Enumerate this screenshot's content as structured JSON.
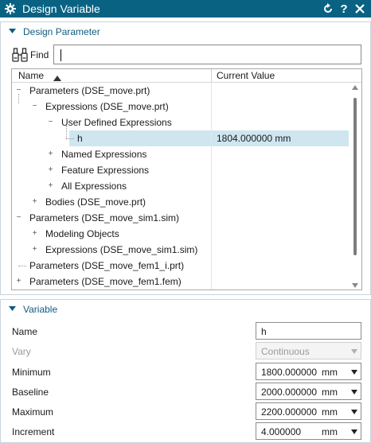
{
  "window": {
    "title": "Design Variable",
    "refresh_icon": "refresh-icon",
    "help_label": "?",
    "close_label": "X"
  },
  "design_parameter": {
    "header": "Design Parameter",
    "find_label": "Find",
    "find_value": "",
    "columns": {
      "name": "Name",
      "current_value": "Current Value"
    },
    "rows": [
      {
        "label": "Parameters (DSE_move.prt)",
        "value": "",
        "state": "expanded"
      },
      {
        "label": "Expressions (DSE_move.prt)",
        "value": "",
        "state": "expanded"
      },
      {
        "label": "User Defined Expressions",
        "value": "",
        "state": "expanded"
      },
      {
        "label": "h",
        "value": "1804.000000 mm",
        "state": "leaf"
      },
      {
        "label": "Named Expressions",
        "value": "",
        "state": "collapsed"
      },
      {
        "label": "Feature Expressions",
        "value": "",
        "state": "collapsed"
      },
      {
        "label": "All Expressions",
        "value": "",
        "state": "collapsed"
      },
      {
        "label": "Bodies (DSE_move.prt)",
        "value": "",
        "state": "collapsed"
      },
      {
        "label": "Parameters (DSE_move_sim1.sim)",
        "value": "",
        "state": "expanded"
      },
      {
        "label": "Modeling Objects",
        "value": "",
        "state": "collapsed"
      },
      {
        "label": "Expressions (DSE_move_sim1.sim)",
        "value": "",
        "state": "collapsed"
      },
      {
        "label": "Parameters (DSE_move_fem1_i.prt)",
        "value": "",
        "state": "leaf"
      },
      {
        "label": "Parameters (DSE_move_fem1.fem)",
        "value": "",
        "state": "collapsed"
      }
    ]
  },
  "variable": {
    "header": "Variable",
    "name_label": "Name",
    "name_value": "h",
    "vary_label": "Vary",
    "vary_value": "Continuous",
    "minimum_label": "Minimum",
    "minimum_value": "1800.000000",
    "baseline_label": "Baseline",
    "baseline_value": "2000.000000",
    "maximum_label": "Maximum",
    "maximum_value": "2200.000000",
    "increment_label": "Increment",
    "increment_value": "4.000000",
    "unit": "mm"
  },
  "colors": {
    "titlebar": "#0a6283",
    "section_header": "#0e5c80",
    "selection": "#cfe6f1"
  }
}
